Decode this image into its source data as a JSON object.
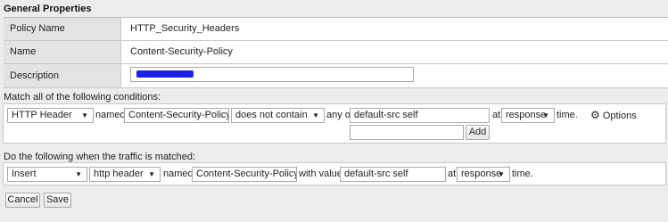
{
  "general": {
    "title": "General Properties",
    "policy_name_label": "Policy Name",
    "policy_name_value": "HTTP_Security_Headers",
    "name_label": "Name",
    "name_value": "Content-Security-Policy",
    "description_label": "Description",
    "description_value": ""
  },
  "conditions": {
    "heading": "Match all of the following conditions:",
    "type_select": "HTTP Header",
    "named_label": "named",
    "header_name": "Content-Security-Policy",
    "operator_select": "does not contain",
    "any_of_label": "any of",
    "value": "default-src self",
    "at_label": "at",
    "at_select": "response",
    "time_label": "time.",
    "options_label": "Options",
    "new_value_placeholder": "",
    "add_button": "Add"
  },
  "actions": {
    "heading": "Do the following when the traffic is matched:",
    "action_select": "Insert",
    "target_select": "http header",
    "named_label": "named",
    "header_name": "Content-Security-Policy",
    "with_value_label": "with value",
    "value": "default-src self",
    "at_label": "at",
    "at_select": "response",
    "time_label": "time."
  },
  "buttons": {
    "cancel": "Cancel",
    "save": "Save"
  }
}
